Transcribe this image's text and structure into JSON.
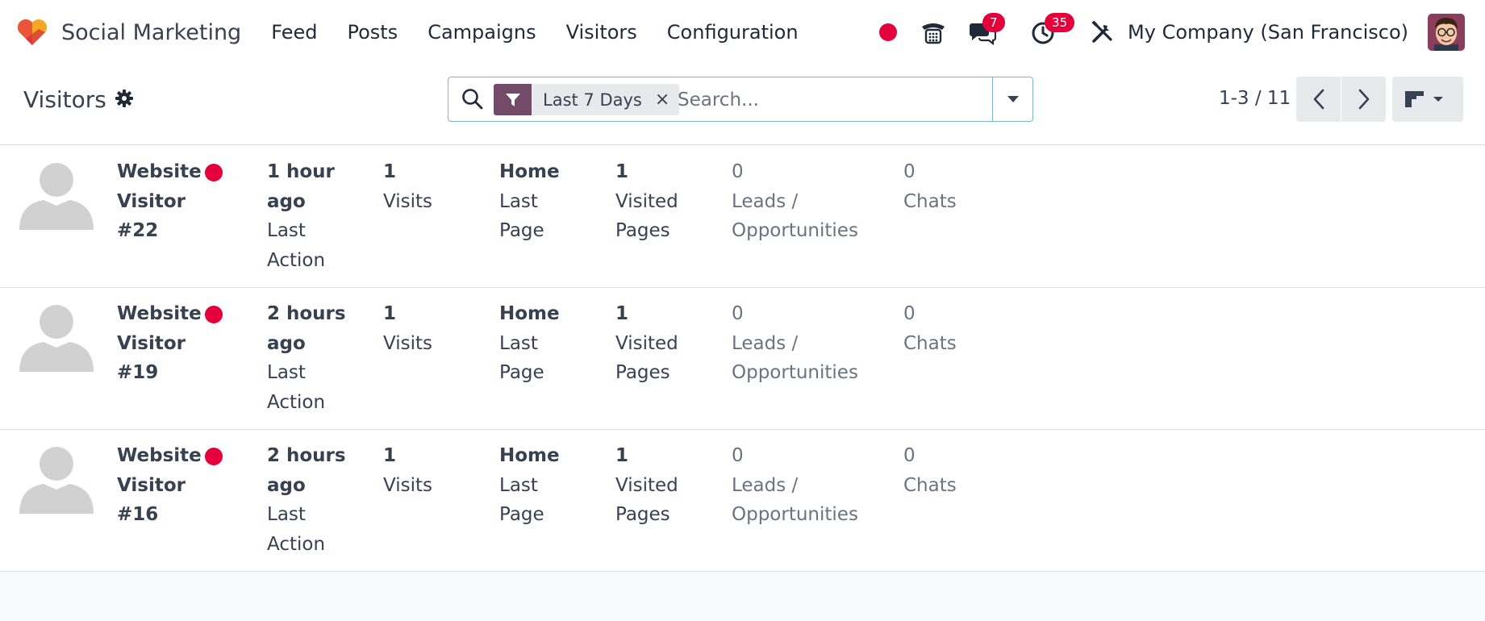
{
  "app": {
    "name": "Social Marketing",
    "menu": [
      "Feed",
      "Posts",
      "Campaigns",
      "Visitors",
      "Configuration"
    ]
  },
  "systray": {
    "messages_count": "7",
    "activities_count": "35",
    "company": "My Company (San Francisco)"
  },
  "control_panel": {
    "title": "Visitors",
    "facet_label": "Last 7 Days",
    "facet_remove": "×",
    "search_placeholder": "Search...",
    "pager": "1-3 / 11"
  },
  "records": [
    {
      "name_line1": "Website",
      "name_line2": "Visitor",
      "name_line3": "#22",
      "last_action_value_1": "1 hour",
      "last_action_value_2": "ago",
      "last_action_label_1": "Last",
      "last_action_label_2": "Action",
      "visits_value": "1",
      "visits_label": "Visits",
      "page_value": "Home",
      "page_label_1": "Last",
      "page_label_2": "Page",
      "visited_value": "1",
      "visited_label_1": "Visited",
      "visited_label_2": "Pages",
      "leads_value": "0",
      "leads_label_1": "Leads /",
      "leads_label_2": "Opportunities",
      "chats_value": "0",
      "chats_label": "Chats"
    },
    {
      "name_line1": "Website",
      "name_line2": "Visitor",
      "name_line3": "#19",
      "last_action_value_1": "2 hours",
      "last_action_value_2": "ago",
      "last_action_label_1": "Last",
      "last_action_label_2": "Action",
      "visits_value": "1",
      "visits_label": "Visits",
      "page_value": "Home",
      "page_label_1": "Last",
      "page_label_2": "Page",
      "visited_value": "1",
      "visited_label_1": "Visited",
      "visited_label_2": "Pages",
      "leads_value": "0",
      "leads_label_1": "Leads /",
      "leads_label_2": "Opportunities",
      "chats_value": "0",
      "chats_label": "Chats"
    },
    {
      "name_line1": "Website",
      "name_line2": "Visitor",
      "name_line3": "#16",
      "last_action_value_1": "2 hours",
      "last_action_value_2": "ago",
      "last_action_label_1": "Last",
      "last_action_label_2": "Action",
      "visits_value": "1",
      "visits_label": "Visits",
      "page_value": "Home",
      "page_label_1": "Last",
      "page_label_2": "Page",
      "visited_value": "1",
      "visited_label_1": "Visited",
      "visited_label_2": "Pages",
      "leads_value": "0",
      "leads_label_1": "Leads /",
      "leads_label_2": "Opportunities",
      "chats_value": "0",
      "chats_label": "Chats"
    }
  ],
  "colors": {
    "brand_primary": "#714b67",
    "online_status": "#e4003a",
    "badge": "#e4003a"
  },
  "icons": [
    "heart-logo-icon",
    "status-dot-icon",
    "phone-icon",
    "chat-icon",
    "clock-icon",
    "tools-icon",
    "gear-icon",
    "search-icon",
    "filter-icon",
    "caret-down-icon",
    "chevron-left-icon",
    "chevron-right-icon",
    "kanban-view-icon",
    "default-avatar-icon"
  ]
}
